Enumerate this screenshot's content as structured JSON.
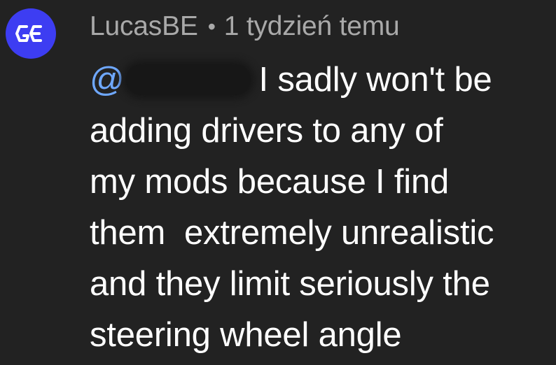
{
  "comment": {
    "author": "LucasBE",
    "separator": "•",
    "timestamp": "1 tydzień temu",
    "avatar_icon": "ge-logo-icon",
    "avatar_color": "#3d3df2",
    "avatar_text": "GE",
    "mention_symbol": "@",
    "lines": [
      "I sadly won't be",
      "adding drivers to any of",
      "my mods because I find",
      "them  extremely unrealistic",
      "and they limit seriously the",
      "steering wheel angle"
    ]
  }
}
